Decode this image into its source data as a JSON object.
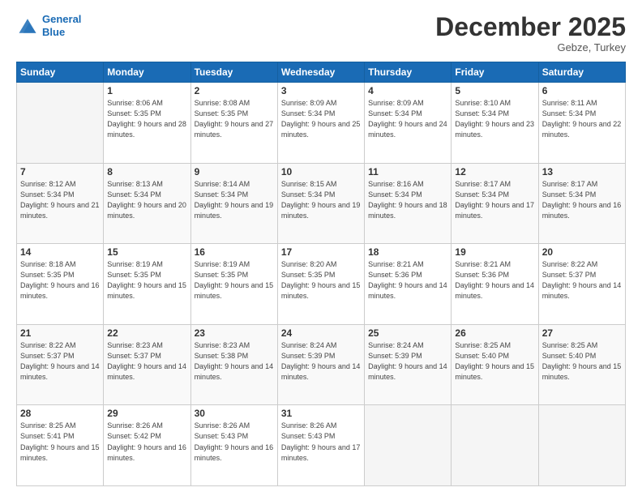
{
  "header": {
    "logo_line1": "General",
    "logo_line2": "Blue",
    "month": "December 2025",
    "location": "Gebze, Turkey"
  },
  "weekdays": [
    "Sunday",
    "Monday",
    "Tuesday",
    "Wednesday",
    "Thursday",
    "Friday",
    "Saturday"
  ],
  "weeks": [
    [
      {
        "day": "",
        "sunrise": "",
        "sunset": "",
        "daylight": ""
      },
      {
        "day": "1",
        "sunrise": "8:06 AM",
        "sunset": "5:35 PM",
        "daylight": "9 hours and 28 minutes."
      },
      {
        "day": "2",
        "sunrise": "8:08 AM",
        "sunset": "5:35 PM",
        "daylight": "9 hours and 27 minutes."
      },
      {
        "day": "3",
        "sunrise": "8:09 AM",
        "sunset": "5:34 PM",
        "daylight": "9 hours and 25 minutes."
      },
      {
        "day": "4",
        "sunrise": "8:09 AM",
        "sunset": "5:34 PM",
        "daylight": "9 hours and 24 minutes."
      },
      {
        "day": "5",
        "sunrise": "8:10 AM",
        "sunset": "5:34 PM",
        "daylight": "9 hours and 23 minutes."
      },
      {
        "day": "6",
        "sunrise": "8:11 AM",
        "sunset": "5:34 PM",
        "daylight": "9 hours and 22 minutes."
      }
    ],
    [
      {
        "day": "7",
        "sunrise": "8:12 AM",
        "sunset": "5:34 PM",
        "daylight": "9 hours and 21 minutes."
      },
      {
        "day": "8",
        "sunrise": "8:13 AM",
        "sunset": "5:34 PM",
        "daylight": "9 hours and 20 minutes."
      },
      {
        "day": "9",
        "sunrise": "8:14 AM",
        "sunset": "5:34 PM",
        "daylight": "9 hours and 19 minutes."
      },
      {
        "day": "10",
        "sunrise": "8:15 AM",
        "sunset": "5:34 PM",
        "daylight": "9 hours and 19 minutes."
      },
      {
        "day": "11",
        "sunrise": "8:16 AM",
        "sunset": "5:34 PM",
        "daylight": "9 hours and 18 minutes."
      },
      {
        "day": "12",
        "sunrise": "8:17 AM",
        "sunset": "5:34 PM",
        "daylight": "9 hours and 17 minutes."
      },
      {
        "day": "13",
        "sunrise": "8:17 AM",
        "sunset": "5:34 PM",
        "daylight": "9 hours and 16 minutes."
      }
    ],
    [
      {
        "day": "14",
        "sunrise": "8:18 AM",
        "sunset": "5:35 PM",
        "daylight": "9 hours and 16 minutes."
      },
      {
        "day": "15",
        "sunrise": "8:19 AM",
        "sunset": "5:35 PM",
        "daylight": "9 hours and 15 minutes."
      },
      {
        "day": "16",
        "sunrise": "8:19 AM",
        "sunset": "5:35 PM",
        "daylight": "9 hours and 15 minutes."
      },
      {
        "day": "17",
        "sunrise": "8:20 AM",
        "sunset": "5:35 PM",
        "daylight": "9 hours and 15 minutes."
      },
      {
        "day": "18",
        "sunrise": "8:21 AM",
        "sunset": "5:36 PM",
        "daylight": "9 hours and 14 minutes."
      },
      {
        "day": "19",
        "sunrise": "8:21 AM",
        "sunset": "5:36 PM",
        "daylight": "9 hours and 14 minutes."
      },
      {
        "day": "20",
        "sunrise": "8:22 AM",
        "sunset": "5:37 PM",
        "daylight": "9 hours and 14 minutes."
      }
    ],
    [
      {
        "day": "21",
        "sunrise": "8:22 AM",
        "sunset": "5:37 PM",
        "daylight": "9 hours and 14 minutes."
      },
      {
        "day": "22",
        "sunrise": "8:23 AM",
        "sunset": "5:37 PM",
        "daylight": "9 hours and 14 minutes."
      },
      {
        "day": "23",
        "sunrise": "8:23 AM",
        "sunset": "5:38 PM",
        "daylight": "9 hours and 14 minutes."
      },
      {
        "day": "24",
        "sunrise": "8:24 AM",
        "sunset": "5:39 PM",
        "daylight": "9 hours and 14 minutes."
      },
      {
        "day": "25",
        "sunrise": "8:24 AM",
        "sunset": "5:39 PM",
        "daylight": "9 hours and 14 minutes."
      },
      {
        "day": "26",
        "sunrise": "8:25 AM",
        "sunset": "5:40 PM",
        "daylight": "9 hours and 15 minutes."
      },
      {
        "day": "27",
        "sunrise": "8:25 AM",
        "sunset": "5:40 PM",
        "daylight": "9 hours and 15 minutes."
      }
    ],
    [
      {
        "day": "28",
        "sunrise": "8:25 AM",
        "sunset": "5:41 PM",
        "daylight": "9 hours and 15 minutes."
      },
      {
        "day": "29",
        "sunrise": "8:26 AM",
        "sunset": "5:42 PM",
        "daylight": "9 hours and 16 minutes."
      },
      {
        "day": "30",
        "sunrise": "8:26 AM",
        "sunset": "5:43 PM",
        "daylight": "9 hours and 16 minutes."
      },
      {
        "day": "31",
        "sunrise": "8:26 AM",
        "sunset": "5:43 PM",
        "daylight": "9 hours and 17 minutes."
      },
      {
        "day": "",
        "sunrise": "",
        "sunset": "",
        "daylight": ""
      },
      {
        "day": "",
        "sunrise": "",
        "sunset": "",
        "daylight": ""
      },
      {
        "day": "",
        "sunrise": "",
        "sunset": "",
        "daylight": ""
      }
    ]
  ]
}
